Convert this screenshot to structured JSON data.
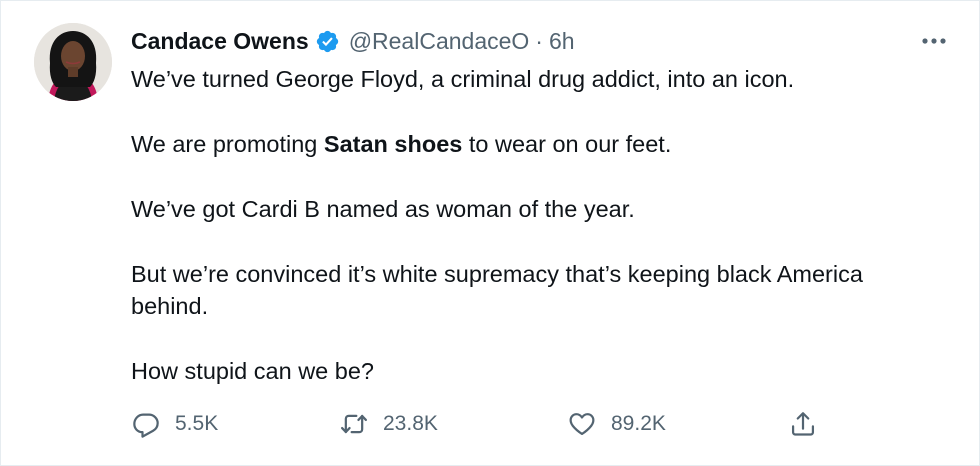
{
  "author": {
    "name": "Candace Owens",
    "handle": "@RealCandaceO",
    "separator": "·",
    "time": "6h",
    "verified_icon": "verified-badge-icon",
    "avatar_icon": "profile-photo"
  },
  "tweet": {
    "p1": "We’ve turned George Floyd, a criminal drug addict, into an icon.",
    "p2_before": "We are promoting ",
    "p2_bold": "Satan shoes",
    "p2_after": " to wear on our feet.",
    "p3": "We’ve got Cardi B named as woman of the year.",
    "p4_line1": "But we’re convinced it’s white supremacy that’s keeping black America",
    "p4_line2": "behind.",
    "p5": "How stupid can we be?"
  },
  "actions": {
    "reply_count": "5.5K",
    "retweet_count": "23.8K",
    "like_count": "89.2K",
    "reply_icon": "reply-icon",
    "retweet_icon": "retweet-icon",
    "like_icon": "heart-icon",
    "share_icon": "share-icon",
    "more_icon": "more-options-icon"
  },
  "colors": {
    "text": "#0f1419",
    "secondary": "#536471",
    "verified": "#1d9bf0",
    "border": "#e6ecf0"
  }
}
